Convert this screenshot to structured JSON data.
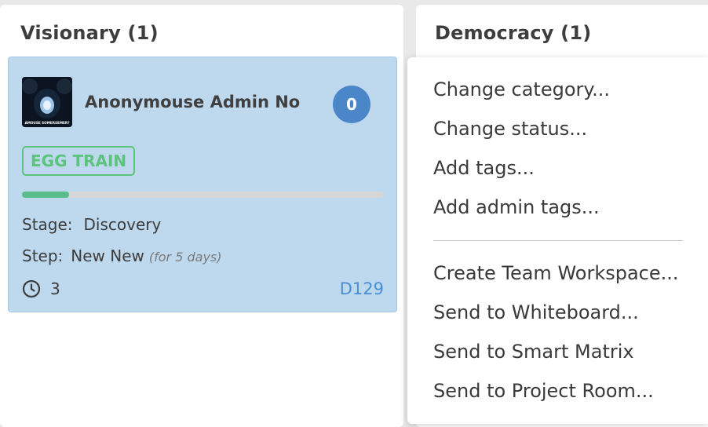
{
  "columns": [
    {
      "title": "Visionary (1)"
    },
    {
      "title": "Democracy (1)"
    }
  ],
  "card": {
    "title": "Anonymouse Admin No",
    "avatar_caption": "AMOUSE SOMERSEMER?",
    "comment_count": "0",
    "tag": "EGG TRAIN",
    "progress": 0.13,
    "stage_label": "Stage:",
    "stage_value": "Discovery",
    "step_label": "Step:",
    "step_value": "New New",
    "step_duration": "(for 5 days)",
    "time_count": "3",
    "id": "D129",
    "icons": {
      "time": "clock-icon"
    }
  },
  "context_menu": {
    "group1": [
      "Change category...",
      "Change status...",
      "Add tags...",
      "Add admin tags..."
    ],
    "group2": [
      "Create Team Workspace...",
      "Send to Whiteboard...",
      "Send to Smart Matrix",
      "Send to Project Room..."
    ]
  },
  "colors": {
    "card_bg": "#bed8ee",
    "badge": "#4a86c8",
    "tag": "#5cc47d",
    "progress": "#56bd8b",
    "id_link": "#4a90d4"
  }
}
